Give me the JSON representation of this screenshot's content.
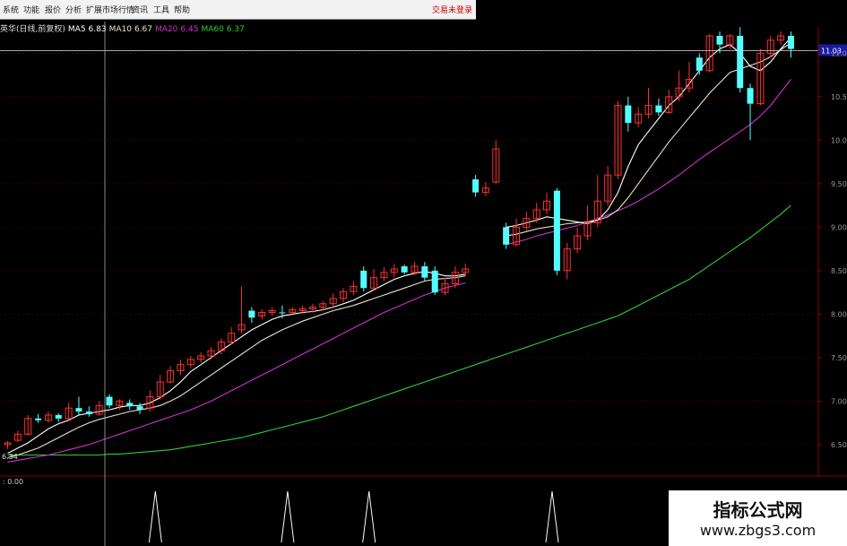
{
  "menu": {
    "items": [
      "系统",
      "功能",
      "报价",
      "分析",
      "扩展市场行情",
      "资讯",
      "工具",
      "帮助"
    ],
    "login": "交易未登录"
  },
  "legend": {
    "name": "英华(日线,前复权)",
    "ma5_label": "MA5",
    "ma5": "6.83",
    "ma10_label": "MA10",
    "ma10": "6.67",
    "ma20_label": "MA20",
    "ma20": "6.45",
    "ma60_label": "MA60",
    "ma60": "6.37"
  },
  "colors": {
    "background": "#000000",
    "up_candle": "#ff3030",
    "down_candle": "#54ffff",
    "ma5": "#ffffff",
    "ma10": "#e8e0c8",
    "ma20": "#cc33cc",
    "ma60": "#33cc33",
    "indicator": "#ffffff"
  },
  "price_tag": "11.03",
  "low_tag": "6.34",
  "indicator_value": "0.00",
  "watermark": {
    "title": "指标公式网",
    "url": "www.zbgs3.com"
  },
  "chart_data": {
    "type": "candlestick",
    "y_ticks": [
      "11.00",
      "10.50",
      "10.00",
      "9.50",
      "9.00",
      "8.50",
      "8.00",
      "7.50",
      "7.00",
      "6.50"
    ],
    "ylim": [
      6.2,
      11.2
    ],
    "crosshair_price": 11.03,
    "candles": [
      [
        6.5,
        6.52,
        6.45,
        6.54
      ],
      [
        6.55,
        6.62,
        6.53,
        6.66
      ],
      [
        6.62,
        6.8,
        6.6,
        6.84
      ],
      [
        6.8,
        6.78,
        6.75,
        6.85
      ],
      [
        6.78,
        6.84,
        6.75,
        6.88
      ],
      [
        6.84,
        6.8,
        6.76,
        6.86
      ],
      [
        6.8,
        6.92,
        6.78,
        6.98
      ],
      [
        6.92,
        6.88,
        6.84,
        7.05
      ],
      [
        6.88,
        6.85,
        6.82,
        6.94
      ],
      [
        6.85,
        6.95,
        6.83,
        7.0
      ],
      [
        7.05,
        6.95,
        6.92,
        7.08
      ],
      [
        6.95,
        7.0,
        6.9,
        7.02
      ],
      [
        6.98,
        6.94,
        6.9,
        7.02
      ],
      [
        6.94,
        6.9,
        6.85,
        6.98
      ],
      [
        6.92,
        7.05,
        6.88,
        7.12
      ],
      [
        7.05,
        7.22,
        7.02,
        7.3
      ],
      [
        7.22,
        7.35,
        7.2,
        7.4
      ],
      [
        7.35,
        7.42,
        7.3,
        7.48
      ],
      [
        7.42,
        7.48,
        7.38,
        7.52
      ],
      [
        7.48,
        7.52,
        7.44,
        7.56
      ],
      [
        7.52,
        7.58,
        7.48,
        7.62
      ],
      [
        7.58,
        7.68,
        7.54,
        7.72
      ],
      [
        7.68,
        7.78,
        7.65,
        7.85
      ],
      [
        7.82,
        7.88,
        7.78,
        8.32
      ],
      [
        8.04,
        7.96,
        7.9,
        8.08
      ],
      [
        7.98,
        8.02,
        7.94,
        8.06
      ],
      [
        8.02,
        8.04,
        7.98,
        8.08
      ],
      [
        8.02,
        8.01,
        7.95,
        8.1
      ],
      [
        8.02,
        8.05,
        8.0,
        8.08
      ],
      [
        8.04,
        8.06,
        8.0,
        8.1
      ],
      [
        8.06,
        8.08,
        8.02,
        8.12
      ],
      [
        8.08,
        8.12,
        8.04,
        8.15
      ],
      [
        8.12,
        8.18,
        8.08,
        8.24
      ],
      [
        8.18,
        8.26,
        8.14,
        8.3
      ],
      [
        8.26,
        8.32,
        8.22,
        8.38
      ],
      [
        8.5,
        8.3,
        8.26,
        8.55
      ],
      [
        8.3,
        8.42,
        8.28,
        8.52
      ],
      [
        8.42,
        8.48,
        8.38,
        8.54
      ],
      [
        8.48,
        8.52,
        8.42,
        8.58
      ],
      [
        8.55,
        8.48,
        8.46,
        8.57
      ],
      [
        8.48,
        8.55,
        8.45,
        8.6
      ],
      [
        8.55,
        8.42,
        8.38,
        8.6
      ],
      [
        8.5,
        8.25,
        8.22,
        8.55
      ],
      [
        8.25,
        8.35,
        8.22,
        8.42
      ],
      [
        8.35,
        8.48,
        8.3,
        8.55
      ],
      [
        8.48,
        8.52,
        8.44,
        8.58
      ],
      [
        9.55,
        9.4,
        9.35,
        9.6
      ],
      [
        9.4,
        9.45,
        9.36,
        9.52
      ],
      [
        9.52,
        9.9,
        9.5,
        10.0
      ],
      [
        9.0,
        8.8,
        8.75,
        9.05
      ],
      [
        8.8,
        9.0,
        8.78,
        9.1
      ],
      [
        9.0,
        9.1,
        8.96,
        9.18
      ],
      [
        9.1,
        9.2,
        9.05,
        9.28
      ],
      [
        9.2,
        9.3,
        9.15,
        9.4
      ],
      [
        9.42,
        8.5,
        8.45,
        9.45
      ],
      [
        8.5,
        8.75,
        8.4,
        8.82
      ],
      [
        8.75,
        8.9,
        8.7,
        9.0
      ],
      [
        8.9,
        9.05,
        8.85,
        9.25
      ],
      [
        9.05,
        9.3,
        9.0,
        9.6
      ],
      [
        9.3,
        9.6,
        9.25,
        9.7
      ],
      [
        9.6,
        10.4,
        9.55,
        10.45
      ],
      [
        10.4,
        10.2,
        10.1,
        10.5
      ],
      [
        10.2,
        10.3,
        10.15,
        10.38
      ],
      [
        10.3,
        10.4,
        10.25,
        10.6
      ],
      [
        10.4,
        10.32,
        10.28,
        10.48
      ],
      [
        10.32,
        10.5,
        10.3,
        10.58
      ],
      [
        10.5,
        10.6,
        10.45,
        10.8
      ],
      [
        10.6,
        10.7,
        10.55,
        10.9
      ],
      [
        10.95,
        10.8,
        10.75,
        11.0
      ],
      [
        10.8,
        11.2,
        10.78,
        11.22
      ],
      [
        11.2,
        11.1,
        11.0,
        11.25
      ],
      [
        11.1,
        11.2,
        11.05,
        11.22
      ],
      [
        11.2,
        10.6,
        10.55,
        11.3
      ],
      [
        10.6,
        10.42,
        10.0,
        10.65
      ],
      [
        10.42,
        11.0,
        10.4,
        11.05
      ],
      [
        11.0,
        11.15,
        10.95,
        11.2
      ],
      [
        11.15,
        11.2,
        11.1,
        11.25
      ],
      [
        11.2,
        11.05,
        10.95,
        11.25
      ]
    ],
    "ma_series": [
      {
        "name": "MA5",
        "values": [
          6.4,
          6.46,
          6.52,
          6.6,
          6.68,
          6.74,
          6.78,
          6.84,
          6.86,
          6.88,
          6.9,
          6.93,
          6.95,
          6.95,
          6.98,
          7.04,
          7.12,
          7.22,
          7.34,
          7.42,
          7.5,
          7.58,
          7.66,
          7.74,
          7.82,
          7.88,
          7.94,
          7.98,
          8.0,
          8.02,
          8.03,
          8.05,
          8.08,
          8.12,
          8.16,
          8.22,
          8.28,
          8.34,
          8.4,
          8.44,
          8.47,
          8.49,
          8.47,
          8.44,
          8.44,
          8.46,
          null,
          null,
          null,
          9.0,
          9.02,
          9.05,
          9.08,
          9.12,
          9.1,
          9.08,
          9.06,
          9.04,
          9.08,
          9.2,
          9.4,
          9.7,
          9.95,
          10.1,
          10.25,
          10.4,
          10.5,
          10.65,
          10.8,
          10.95,
          11.05,
          11.1,
          11.0,
          10.85,
          10.8,
          10.9,
          11.05,
          11.18
        ]
      },
      {
        "name": "MA10",
        "values": [
          6.35,
          6.38,
          6.42,
          6.46,
          6.52,
          6.58,
          6.64,
          6.7,
          6.75,
          6.79,
          6.82,
          6.85,
          6.88,
          6.9,
          6.92,
          6.95,
          7.0,
          7.06,
          7.14,
          7.22,
          7.3,
          7.38,
          7.46,
          7.54,
          7.62,
          7.7,
          7.76,
          7.82,
          7.87,
          7.92,
          7.96,
          8.0,
          8.04,
          8.07,
          8.1,
          8.14,
          8.18,
          8.22,
          8.26,
          8.3,
          8.34,
          8.38,
          8.4,
          8.41,
          8.42,
          8.44,
          null,
          null,
          null,
          8.9,
          8.92,
          8.95,
          8.98,
          9.0,
          9.02,
          9.04,
          9.05,
          9.06,
          9.08,
          9.12,
          9.2,
          9.34,
          9.5,
          9.66,
          9.82,
          9.98,
          10.12,
          10.26,
          10.4,
          10.54,
          10.66,
          10.78,
          10.82,
          10.86,
          10.9,
          10.96,
          11.04,
          11.12
        ]
      },
      {
        "name": "MA20",
        "values": [
          6.3,
          6.32,
          6.34,
          6.36,
          6.38,
          6.41,
          6.44,
          6.47,
          6.5,
          6.54,
          6.58,
          6.62,
          6.66,
          6.7,
          6.74,
          6.78,
          6.82,
          6.86,
          6.9,
          6.95,
          7.0,
          7.06,
          7.12,
          7.18,
          7.24,
          7.3,
          7.36,
          7.42,
          7.48,
          7.54,
          7.6,
          7.66,
          7.72,
          7.78,
          7.84,
          7.9,
          7.96,
          8.02,
          8.07,
          8.12,
          8.17,
          8.22,
          8.26,
          8.3,
          8.33,
          8.36,
          null,
          null,
          null,
          8.8,
          8.83,
          8.86,
          8.9,
          8.93,
          8.96,
          8.99,
          9.02,
          9.06,
          9.1,
          9.14,
          9.19,
          9.24,
          9.3,
          9.37,
          9.44,
          9.52,
          9.6,
          9.69,
          9.78,
          9.86,
          9.94,
          10.02,
          10.1,
          10.18,
          10.28,
          10.4,
          10.55,
          10.7
        ]
      },
      {
        "name": "MA60",
        "values": [
          6.38,
          6.38,
          6.38,
          6.38,
          6.38,
          6.38,
          6.38,
          6.38,
          6.38,
          6.38,
          6.39,
          6.39,
          6.4,
          6.41,
          6.42,
          6.43,
          6.44,
          6.46,
          6.48,
          6.5,
          6.52,
          6.54,
          6.56,
          6.58,
          6.61,
          6.64,
          6.67,
          6.7,
          6.73,
          6.76,
          6.79,
          6.82,
          6.86,
          6.9,
          6.94,
          6.98,
          7.02,
          7.06,
          7.1,
          7.14,
          7.18,
          7.22,
          7.26,
          7.3,
          7.34,
          7.38,
          7.42,
          7.46,
          7.5,
          7.54,
          7.58,
          7.62,
          7.66,
          7.7,
          7.74,
          7.78,
          7.82,
          7.86,
          7.9,
          7.94,
          7.98,
          8.04,
          8.1,
          8.16,
          8.22,
          8.28,
          8.34,
          8.4,
          8.48,
          8.56,
          8.64,
          8.72,
          8.8,
          8.88,
          8.97,
          9.06,
          9.15,
          9.25
        ]
      }
    ],
    "indicator_spikes": [
      11,
      24,
      32,
      50
    ]
  }
}
